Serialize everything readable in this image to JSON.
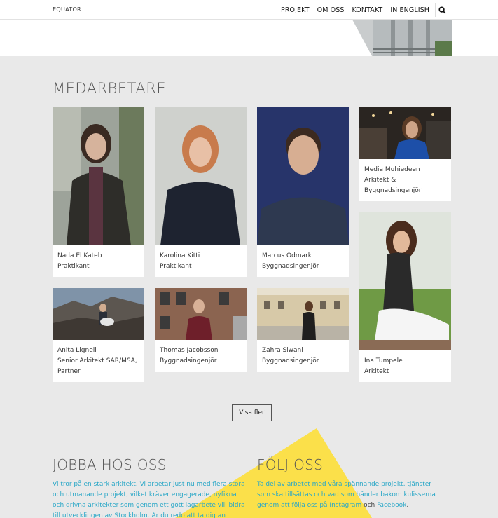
{
  "brand": "EQUATOR",
  "nav": {
    "items": [
      "PROJEKT",
      "OM OSS",
      "KONTAKT",
      "IN ENGLISH"
    ],
    "search_icon": "search-icon"
  },
  "section": {
    "title": "MEDARBETARE"
  },
  "staff": [
    {
      "name": "Nada El Kateb",
      "role": "Praktikant"
    },
    {
      "name": "Karolina Kitti",
      "role": "Praktikant"
    },
    {
      "name": "Marcus Odmark",
      "role": "Byggnadsingenjör"
    },
    {
      "name": "Media Muhiedeen",
      "role_line1": "Arkitekt &",
      "role_line2": "Byggnadsingenjör"
    },
    {
      "name": "Anita Lignell",
      "role_line1": "Senior Arkitekt SAR/MSA,",
      "role_line2": "Partner"
    },
    {
      "name": "Thomas Jacobsson",
      "role": "Byggnadsingenjör"
    },
    {
      "name": "Zahra Siwani",
      "role": "Byggnadsingenjör"
    },
    {
      "name": "Ina Tumpele",
      "role": "Arkitekt"
    }
  ],
  "more_button": "Visa fler",
  "jobs": {
    "title": "JOBBA HOS OSS",
    "lines": [
      "Vi tror på en stark arkitekt. Vi arbetar just nu med flera stora",
      "och utmanande projekt, vilket kräver engagerade, nyfikna",
      "och drivna arkitekter som genom ett gott lagarbete vill bidra",
      "till utvecklingen av Stockholm. Är du redo att ta dig an"
    ]
  },
  "follow": {
    "title": "FÖLJ OSS",
    "line1": "Ta del av arbetet med våra spännande projekt, tjänster",
    "line2": "som ska tillsättas och vad som händer bakom kulisserna",
    "line3_prefix": "genom att följa oss på ",
    "instagram": "Instagram",
    "and": " och ",
    "facebook": "Facebook",
    "period": "."
  },
  "colors": {
    "accent_link": "#2aa7c7",
    "highlight_yellow": "#fbe04a",
    "background": "#e9e9e9"
  }
}
